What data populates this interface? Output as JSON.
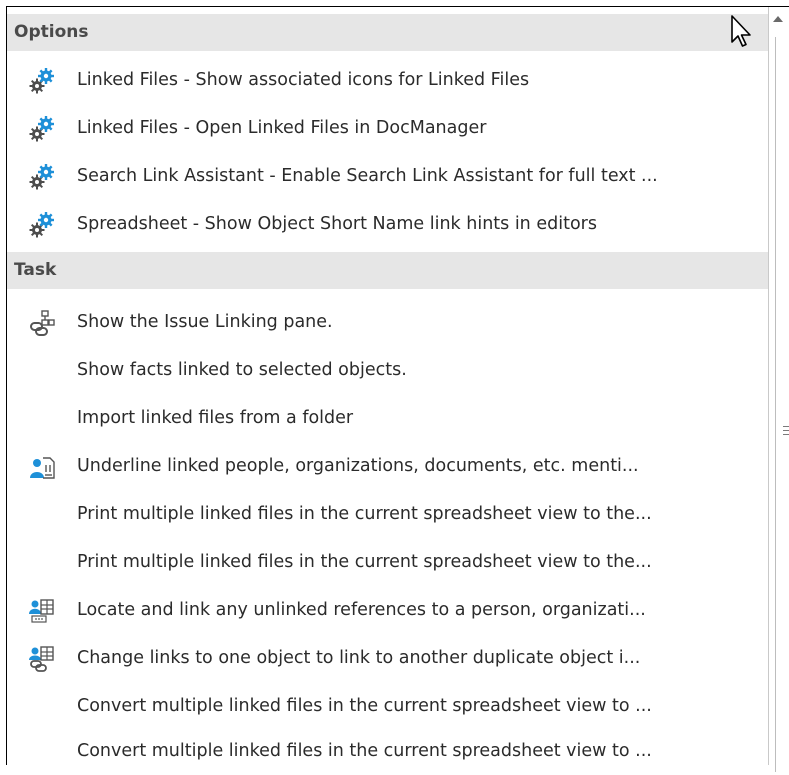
{
  "groups": {
    "options": "Options",
    "task": "Task"
  },
  "options_items": [
    {
      "label": "Linked Files - Show associated icons for Linked Files",
      "icon": "gear-settings-icon"
    },
    {
      "label": "Linked Files - Open Linked Files in DocManager",
      "icon": "gear-settings-icon"
    },
    {
      "label": "Search Link Assistant - Enable Search Link Assistant for full text ...",
      "icon": "gear-settings-icon"
    },
    {
      "label": "Spreadsheet - Show Object Short Name link hints in editors",
      "icon": "gear-settings-icon"
    }
  ],
  "task_items": [
    {
      "label": "Show the Issue Linking pane.",
      "icon": "issue-linking-icon"
    },
    {
      "label": "Show facts linked to selected objects.",
      "icon": ""
    },
    {
      "label": "Import linked files from a folder",
      "icon": ""
    },
    {
      "label": "Underline linked people, organizations, documents, etc. menti...",
      "icon": "person-document-icon"
    },
    {
      "label": "Print multiple linked files in the current spreadsheet view to the...",
      "icon": ""
    },
    {
      "label": "Print multiple linked files in the current spreadsheet view to the...",
      "icon": ""
    },
    {
      "label": "Locate and link any unlinked references to a person, organizati...",
      "icon": "person-table-icon"
    },
    {
      "label": "Change links to one object to link to another duplicate object i...",
      "icon": "person-link-icon"
    },
    {
      "label": "Convert multiple linked files in the current spreadsheet view to ...",
      "icon": ""
    },
    {
      "label": "Convert multiple linked files in the current spreadsheet view to ...",
      "icon": ""
    }
  ],
  "colors": {
    "header_bg": "#e6e6e6",
    "gear_grey": "#4d4d4d",
    "gear_blue": "#1e90d8",
    "person_blue": "#1e90d8"
  }
}
